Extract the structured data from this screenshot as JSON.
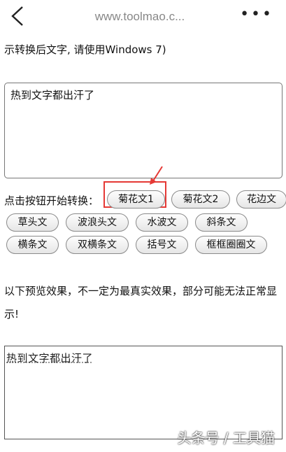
{
  "browser": {
    "url": "www.toolmao.c...",
    "more_label": "•••"
  },
  "top_note": "示转换后文字, 请使用Windows 7)",
  "input": {
    "value": "热到文字都出汗了"
  },
  "prompt_label": "点击按钮开始转换：",
  "buttons": [
    {
      "label": "菊花文1"
    },
    {
      "label": "菊花文2"
    },
    {
      "label": "花边文"
    },
    {
      "label": "草头文"
    },
    {
      "label": "波浪头文"
    },
    {
      "label": "水波文"
    },
    {
      "label": "斜条文"
    },
    {
      "label": "横条文"
    },
    {
      "label": "双横条文"
    },
    {
      "label": "括号文"
    },
    {
      "label": "框框圈圈文"
    }
  ],
  "preview_note": "以下预览效果，不一定为最真实效果，部分可能无法正常显示!",
  "preview_text": "热到文字都出汗了",
  "watermark": "头条号 / 工具猫",
  "colors": {
    "highlight": "#e53935"
  }
}
